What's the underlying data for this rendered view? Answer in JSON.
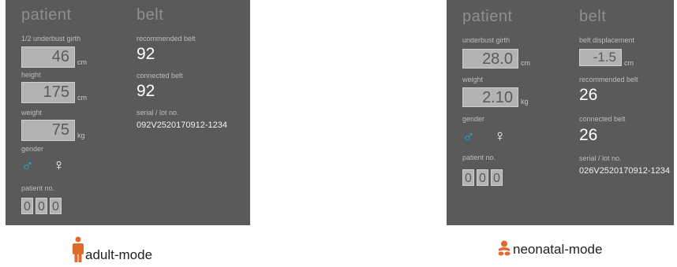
{
  "adult": {
    "patient_heading": "patient",
    "belt_heading": "belt",
    "girth_label": "1/2  underbust girth",
    "girth_value": "46",
    "girth_unit": "cm",
    "height_label": "height",
    "height_value": "175",
    "height_unit": "cm",
    "weight_label": "weight",
    "weight_value": "75",
    "weight_unit": "kg",
    "gender_label": "gender",
    "patient_no_label": "patient no.",
    "patient_no_digits": [
      "0",
      "0",
      "0"
    ],
    "recommended_belt_label": "recommended belt",
    "recommended_belt_value": "92",
    "connected_belt_label": "connected belt",
    "connected_belt_value": "92",
    "serial_label": "serial / lot no.",
    "serial_value": "092V2520170912-1234",
    "caption": "adult-mode"
  },
  "neonatal": {
    "patient_heading": "patient",
    "belt_heading": "belt",
    "girth_label": "underbust girth",
    "girth_value": "28.0",
    "girth_unit": "cm",
    "weight_label": "weight",
    "weight_value": "2.10",
    "weight_unit": "kg",
    "gender_label": "gender",
    "patient_no_label": "patient no.",
    "patient_no_digits": [
      "0",
      "0",
      "0"
    ],
    "displacement_label": "belt displacement",
    "displacement_value": "-1.5",
    "displacement_unit": "cm",
    "recommended_belt_label": "recommended belt",
    "recommended_belt_value": "26",
    "connected_belt_label": "connected belt",
    "connected_belt_value": "26",
    "serial_label": "serial / lot no.",
    "serial_value": "026V2520170912-1234",
    "caption": "neonatal-mode"
  },
  "icons": {
    "male": "male-symbol",
    "female": "female-symbol",
    "adult_caption_icon": "adult-person-icon",
    "neonatal_caption_icon": "baby-icon"
  },
  "colors": {
    "screen_bg": "#5a5a5a",
    "input_bg": "#b3b3b3",
    "male_accent": "#29a3d6",
    "caption_icon": "#e06a2c"
  }
}
